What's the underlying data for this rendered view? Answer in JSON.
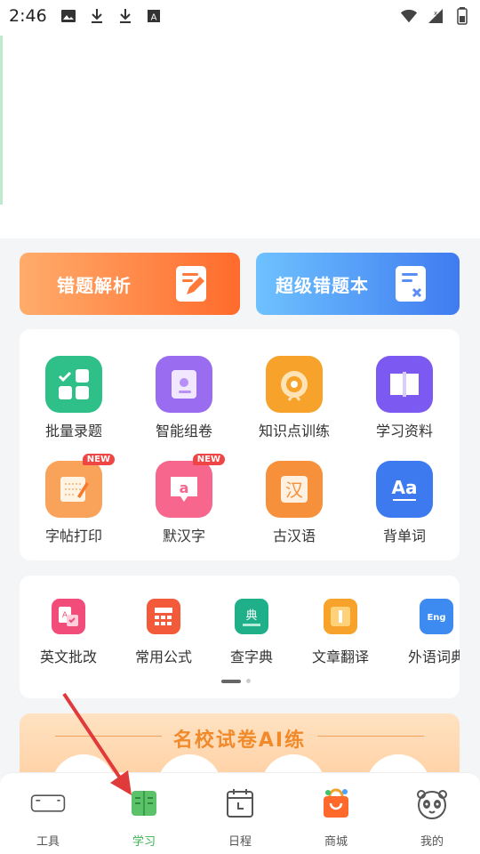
{
  "status_bar": {
    "time": "2:46",
    "left_icons": [
      "image-icon",
      "download-icon",
      "download-icon",
      "a-box-icon"
    ],
    "right_icons": [
      "wifi-icon",
      "signal-icon",
      "battery-icon"
    ]
  },
  "banners": {
    "left": {
      "label": "错题解析",
      "icon": "pencil-note-icon"
    },
    "right": {
      "label": "超级错题本",
      "icon": "note-x-icon"
    }
  },
  "grid": [
    {
      "label": "批量录题",
      "icon": "grid-check-icon",
      "color": "#2fbf88"
    },
    {
      "label": "智能组卷",
      "icon": "paper-icon",
      "color": "#9a6cf0"
    },
    {
      "label": "知识点训练",
      "icon": "target-icon",
      "color": "#f7a22a"
    },
    {
      "label": "学习资料",
      "icon": "book-icon",
      "color": "#7c5af2"
    },
    {
      "label": "字帖打印",
      "icon": "copybook-icon",
      "color": "#f9a25a",
      "badge": "NEW"
    },
    {
      "label": "默汉字",
      "icon": "chat-a-icon",
      "color": "#f6668d",
      "badge": "NEW"
    },
    {
      "label": "古汉语",
      "icon": "han-icon",
      "color": "#f7903a",
      "glyph": "汉"
    },
    {
      "label": "背单词",
      "icon": "aa-icon",
      "color": "#3d7af0",
      "glyph": "Aa"
    }
  ],
  "scroll_items": [
    {
      "label": "英文批改",
      "icon": "english-correct-icon",
      "color": "#f24c7a"
    },
    {
      "label": "常用公式",
      "icon": "calculator-icon",
      "color": "#f25a3a"
    },
    {
      "label": "查字典",
      "icon": "dictionary-icon",
      "color": "#1fb08a",
      "glyph": "典"
    },
    {
      "label": "文章翻译",
      "icon": "translate-icon",
      "color": "#f7a22a"
    },
    {
      "label": "外语词典",
      "icon": "eng-dict-icon",
      "color": "#3d8af0",
      "glyph": "Eng"
    }
  ],
  "promo": {
    "title": "名校试卷AI练"
  },
  "tabs": [
    {
      "label": "工具",
      "icon": "toolbox-icon"
    },
    {
      "label": "学习",
      "icon": "study-book-icon",
      "active": true
    },
    {
      "label": "日程",
      "icon": "calendar-clock-icon"
    },
    {
      "label": "商城",
      "icon": "shopping-bag-icon"
    },
    {
      "label": "我的",
      "icon": "panda-icon"
    }
  ],
  "colors": {
    "active_tab": "#37b24d",
    "arrow": "#e03a3a"
  }
}
